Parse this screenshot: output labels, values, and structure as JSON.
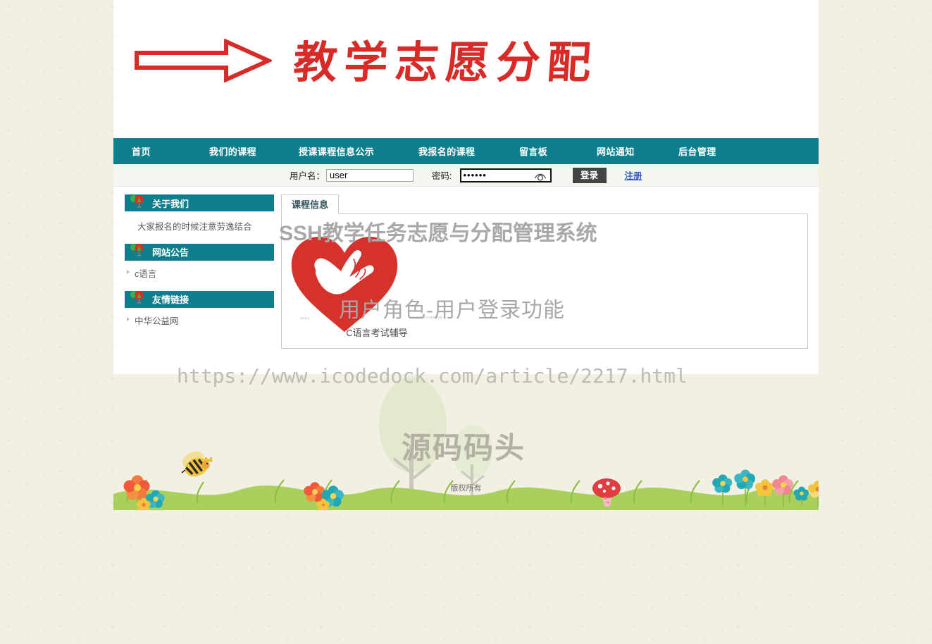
{
  "banner": {
    "arrow_icon": "right-arrow-icon",
    "title": "教学志愿分配"
  },
  "nav": {
    "items": [
      {
        "label": "首页",
        "name": "nav-item-home"
      },
      {
        "label": "我们的课程",
        "name": "nav-item-our-courses"
      },
      {
        "label": "授课课程信息公示",
        "name": "nav-item-course-publicity"
      },
      {
        "label": "我报名的课程",
        "name": "nav-item-my-courses"
      },
      {
        "label": "留言板",
        "name": "nav-item-message-board"
      },
      {
        "label": "网站通知",
        "name": "nav-item-site-notice"
      },
      {
        "label": "后台管理",
        "name": "nav-item-admin"
      }
    ]
  },
  "login": {
    "username_label": "用户名：",
    "username_value": "user",
    "username_placeholder": "",
    "password_label": "密码:",
    "password_value": "••••••",
    "password_placeholder": "",
    "reveal_icon": "eye-icon",
    "login_button": "登录",
    "register_link": "注册"
  },
  "sidebar": {
    "blocks": [
      {
        "title": "关于我们",
        "icon": "tree-sign-icon",
        "text": "大家报名的时候注意劳逸结合",
        "items": []
      },
      {
        "title": "网站公告",
        "icon": "tree-sign-icon",
        "text": "",
        "items": [
          "c语言"
        ]
      },
      {
        "title": "友情链接",
        "icon": "tree-sign-icon",
        "text": "",
        "items": [
          "中华公益网"
        ]
      }
    ]
  },
  "main": {
    "tabs": [
      {
        "label": "课程信息",
        "active": true
      }
    ],
    "courses": [
      {
        "name": "C语言考试辅导",
        "image": "red-heart-hand-logo",
        "caption_left": "源码码头",
        "caption_right": "教学任务志愿与分配管理系统"
      }
    ]
  },
  "footer": {
    "copyright": "版权所有"
  },
  "watermarks": {
    "title": "SSH教学任务志愿与分配管理系统",
    "subtitle": "用户角色-用户登录功能",
    "url": "https://www.icodedock.com/article/2217.html",
    "brand": "源码码头"
  },
  "colors": {
    "nav_teal": "#0c7e8d",
    "title_red": "#d82a27",
    "login_button": "#444444",
    "register_link": "#2a58c6",
    "page_bg": "#f2efe3",
    "watermark_gray": "#a8a8a8"
  }
}
